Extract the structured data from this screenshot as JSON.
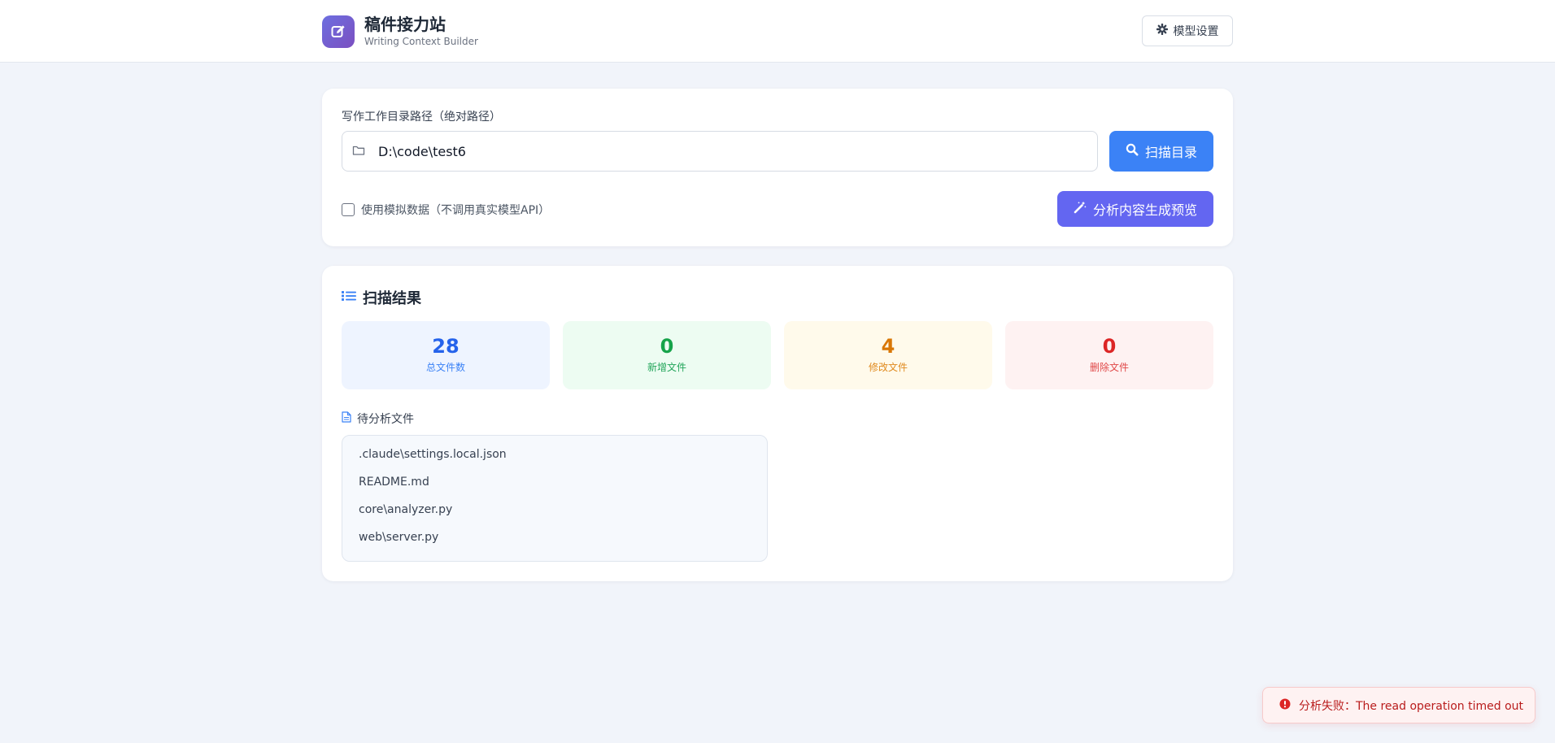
{
  "header": {
    "title": "稿件接力站",
    "subtitle": "Writing Context Builder",
    "settings_label": "模型设置"
  },
  "scan_form": {
    "path_label": "写作工作目录路径（绝对路径）",
    "path_value": "D:\\code\\test6",
    "scan_label": "扫描目录",
    "mock_label": "使用模拟数据（不调用真实模型API）",
    "mock_checked": false,
    "analyze_label": "分析内容生成预览"
  },
  "results": {
    "title": "扫描结果",
    "stats": {
      "total": {
        "value": "28",
        "label": "总文件数"
      },
      "added": {
        "value": "0",
        "label": "新增文件"
      },
      "modified": {
        "value": "4",
        "label": "修改文件"
      },
      "deleted": {
        "value": "0",
        "label": "删除文件"
      }
    },
    "pending_label": "待分析文件",
    "files": [
      ".claude\\settings.local.json",
      "README.md",
      "core\\analyzer.py",
      "web\\server.py"
    ]
  },
  "toast": {
    "message": "分析失败：The read operation timed out"
  },
  "colors": {
    "primary": "#3b82f6",
    "accent": "#6366f1",
    "success": "#16a34a",
    "warning": "#d97706",
    "danger": "#dc2626"
  },
  "icons": {
    "logo": "pencil-square-icon",
    "settings": "gear-icon",
    "folder": "folder-icon",
    "scan": "search-icon",
    "analyze": "magic-wand-icon",
    "results": "list-icon",
    "pending": "file-icon",
    "toast": "exclamation-circle-icon"
  }
}
